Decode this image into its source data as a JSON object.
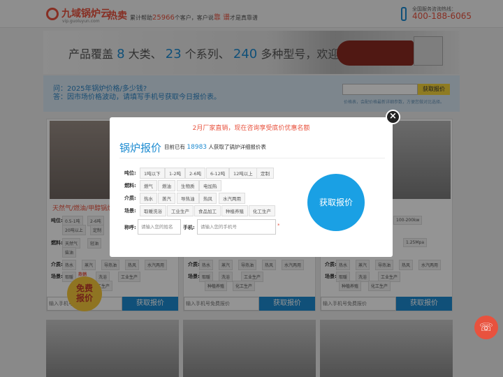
{
  "header": {
    "logo_text": "九域锅炉云",
    "logo_domain": "vip.guoluyun.com",
    "hot_word": "热卖",
    "slogan_prefix": "累计帮助",
    "slogan_count": "25966",
    "slogan_mid": "个客户，客户说",
    "slogan_hl": "靠 谱",
    "slogan_suffix": "才是真靠谱",
    "hotline_label": "全国服务咨询热线：",
    "hotline_number": "400-188-6065"
  },
  "banner": {
    "t1": "产品覆盖",
    "n1": "8",
    "t2": "大类、",
    "n2": "23",
    "t3": "个系列、",
    "n3": "240",
    "t4": "多种型号，欢迎咨询"
  },
  "qa": {
    "question": "问：2025年锅炉价格/多少钱?",
    "answer": "答：因市场价格波动，请填写手机号获取今日报价表。",
    "button": "获取报价",
    "note": "价格表，会配价格最新详细参数，方便您做对比选择。"
  },
  "cards": {
    "card1_title": "天然气/燃油/甲醇锅炉",
    "label_ton": "吨位:",
    "label_fuel": "燃料:",
    "label_medium": "介质:",
    "label_scene": "场景:",
    "c1_chips_row1": [
      "0.5-1吨",
      "2-6吨"
    ],
    "c1_chips_row2": [
      "20吨以上",
      "定制"
    ],
    "c1_fuel": [
      "天然气",
      "轻油"
    ],
    "c1_fuel2": "柴油",
    "c1_medium": [
      "热水",
      "蒸汽",
      "导热油",
      "热风",
      "水汽两用"
    ],
    "c1_scene": [
      "取暖",
      "洗浴",
      "工业生产"
    ],
    "c1_scene2": "化工生产",
    "c3_tons": "100-200kw",
    "c3_pressure": "1.25Mpa",
    "c3_scene": [
      "种植养殖",
      "化工生产"
    ],
    "input_placeholder": "输入手机号免费报价",
    "button": "获取报价",
    "badge_small": "热销",
    "badge_line1": "免费",
    "badge_line2": "报价"
  },
  "modal": {
    "promo": "2月厂家直销，现在咨询享受底价优惠名额",
    "title": "锅炉报价",
    "count_prefix": "目前已有",
    "count": "18983",
    "count_suffix": "人获取了锅炉详细报价表",
    "ton_label": "吨位:",
    "tons": [
      "1吨以下",
      "1-2吨",
      "2-6吨",
      "6-12吨",
      "12吨以上",
      "定制"
    ],
    "fuel_label": "燃料:",
    "fuels": [
      "燃气",
      "燃油",
      "生物质",
      "电加热"
    ],
    "medium_label": "介质:",
    "mediums": [
      "热水",
      "蒸汽",
      "导热油",
      "热风",
      "水汽两用"
    ],
    "scene_label": "场景:",
    "scenes": [
      "取暖洗浴",
      "工业生产",
      "食品加工",
      "种植养殖",
      "化工生产"
    ],
    "name_label": "称呼:",
    "name_placeholder": "请输入您的姓名",
    "phone_label": "手机:",
    "phone_placeholder": "请输入您的手机号",
    "required_mark": "*",
    "quote_button": "获取报价",
    "close": "×"
  },
  "colors": {
    "accent_blue": "#1d8bd1",
    "accent_red": "#e8523e",
    "accent_yellow": "#f5d43b"
  },
  "icons": [
    "boiler-logo-icon",
    "phone-icon",
    "close-icon",
    "float-phone-icon"
  ]
}
